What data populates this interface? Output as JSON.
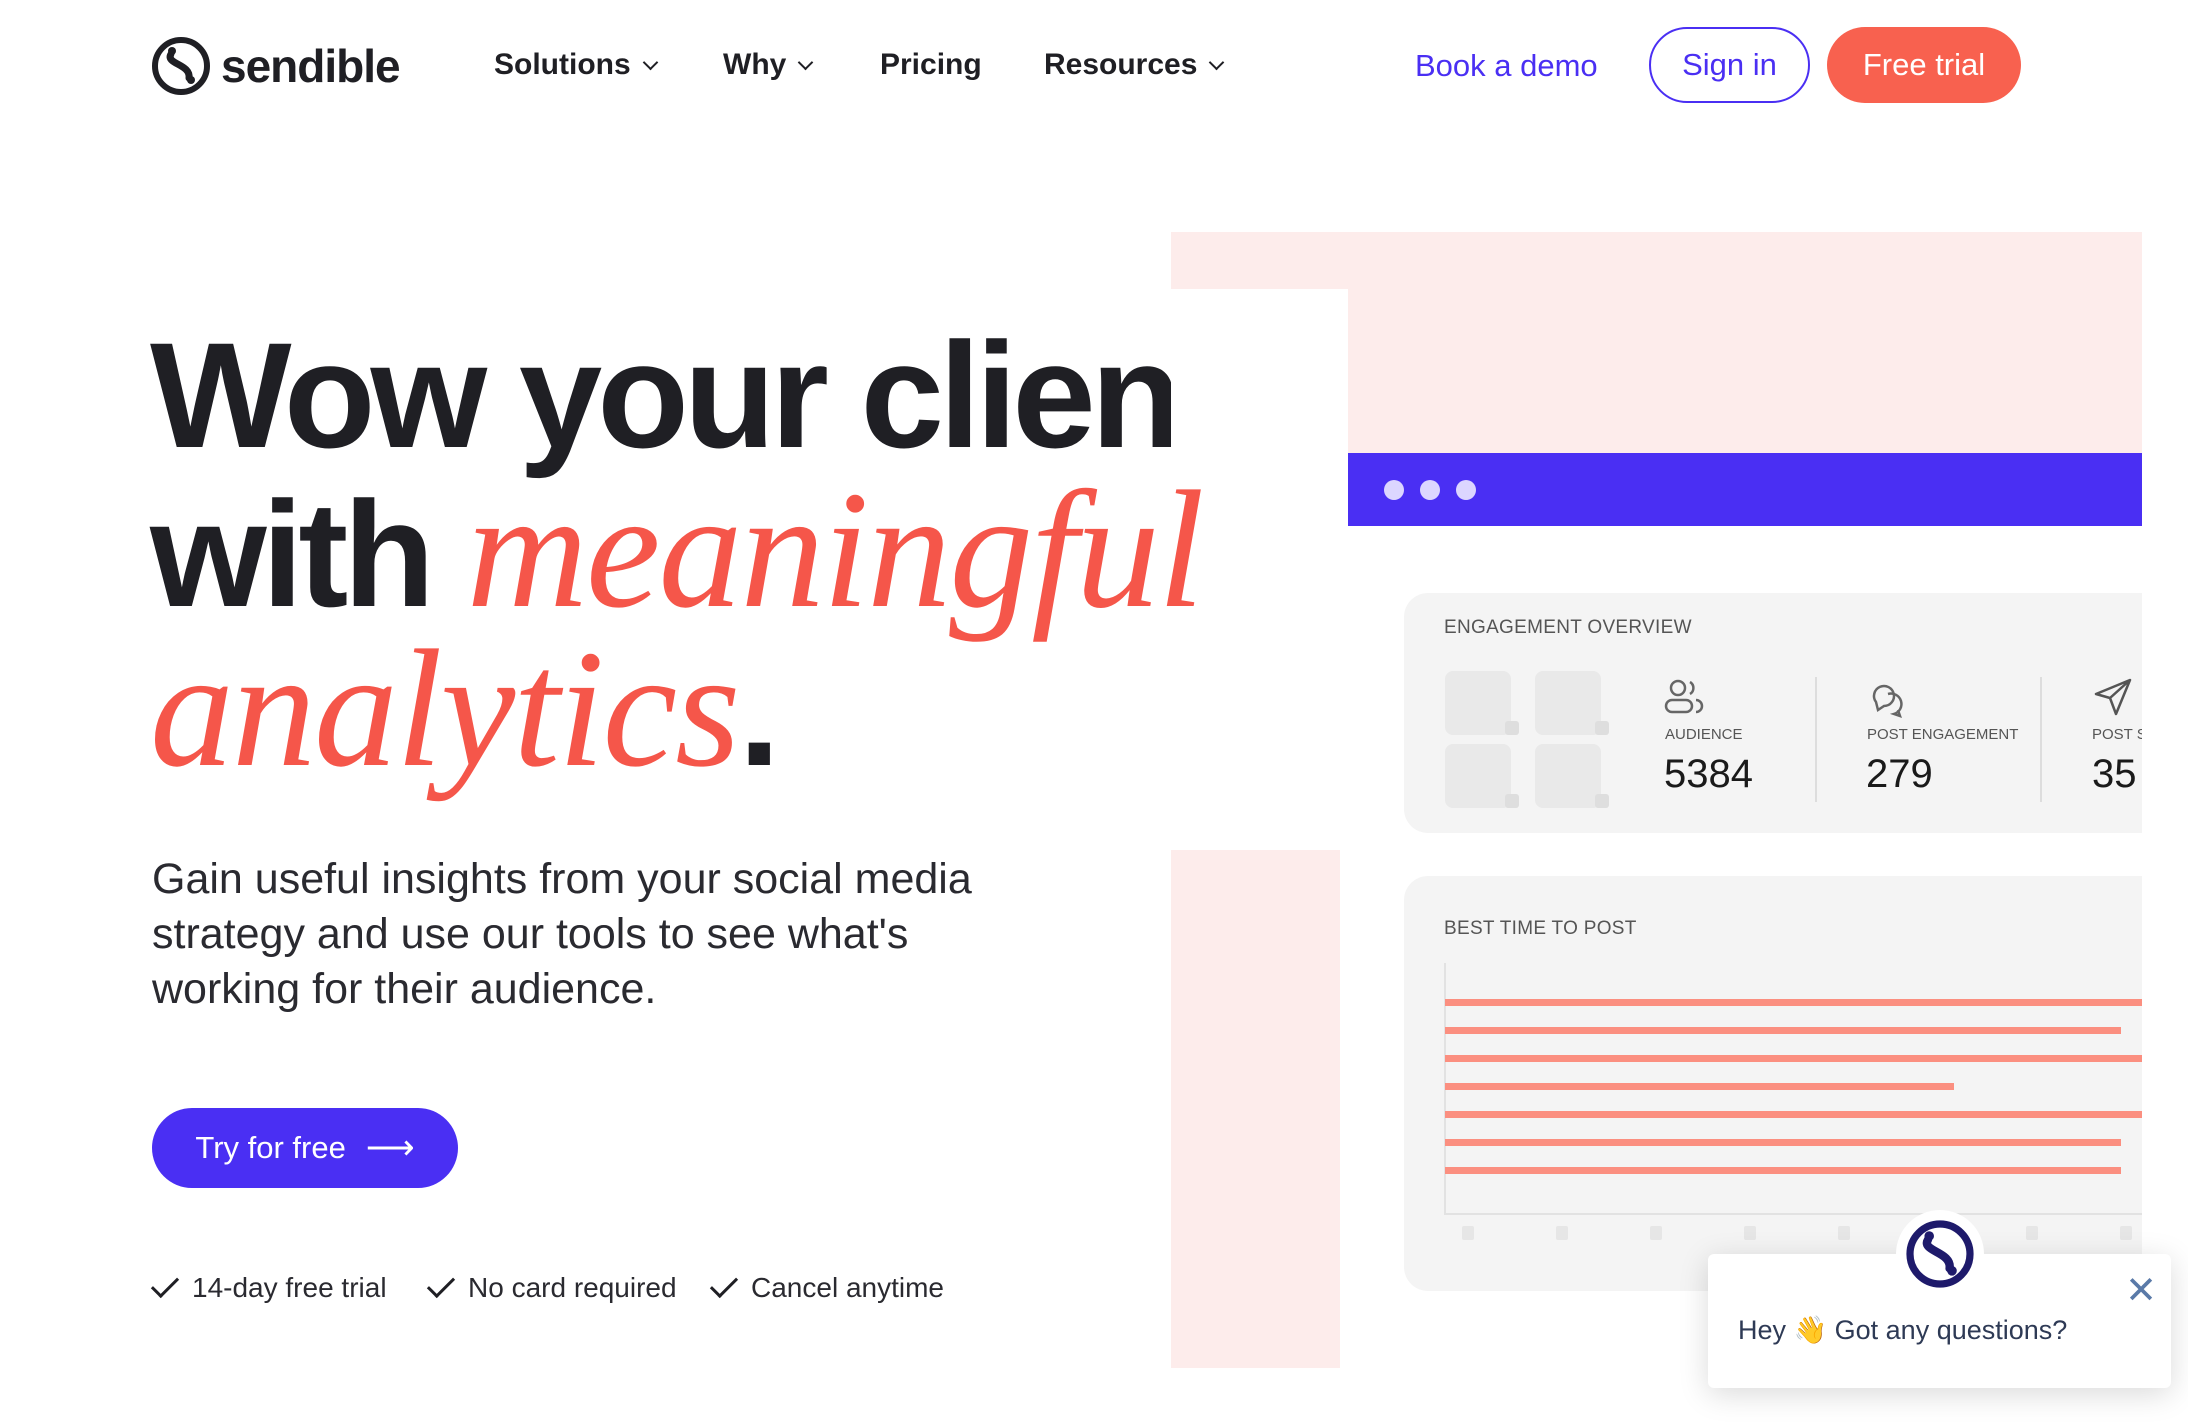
{
  "header": {
    "logo_text": "sendible",
    "nav": [
      {
        "label": "Solutions",
        "has_dropdown": true
      },
      {
        "label": "Why",
        "has_dropdown": true
      },
      {
        "label": "Pricing",
        "has_dropdown": false
      },
      {
        "label": "Resources",
        "has_dropdown": true
      }
    ],
    "book_demo": "Book a demo",
    "sign_in": "Sign in",
    "free_trial": "Free trial"
  },
  "hero": {
    "headline_line1": "Wow your clients",
    "headline_with": "with ",
    "headline_italic1": "meaningful",
    "headline_italic2": "analytics",
    "headline_period": ".",
    "paragraph_lines": [
      "Gain useful insights from your social media",
      "strategy and use our tools to see what's",
      "working for their audience."
    ],
    "cta": "Try for free",
    "checks": [
      "14-day free trial",
      "No card required",
      "Cancel anytime"
    ]
  },
  "mockup": {
    "engagement": {
      "title": "ENGAGEMENT OVERVIEW",
      "metrics": [
        {
          "label": "AUDIENCE",
          "value": "5384",
          "icon": "users-icon"
        },
        {
          "label": "POST ENGAGEMENT",
          "value": "279",
          "icon": "chat-bubbles-icon"
        },
        {
          "label": "POST S",
          "value": "35",
          "icon": "send-icon"
        }
      ]
    },
    "best_time": {
      "title": "BEST TIME TO POST",
      "chart_data": {
        "type": "bar",
        "orientation": "horizontal",
        "values_pct_of_visible_width": [
          100,
          97,
          100,
          73,
          100,
          97,
          97
        ],
        "tick_count": 8
      }
    }
  },
  "chat": {
    "message": "Hey 👋 Got any questions?"
  },
  "colors": {
    "accent_coral": "#f8614f",
    "accent_purple": "#4a2ff3",
    "pink_bg": "#fdeceb",
    "text": "#1f1f24",
    "chat_navy": "#1e1a6b"
  }
}
